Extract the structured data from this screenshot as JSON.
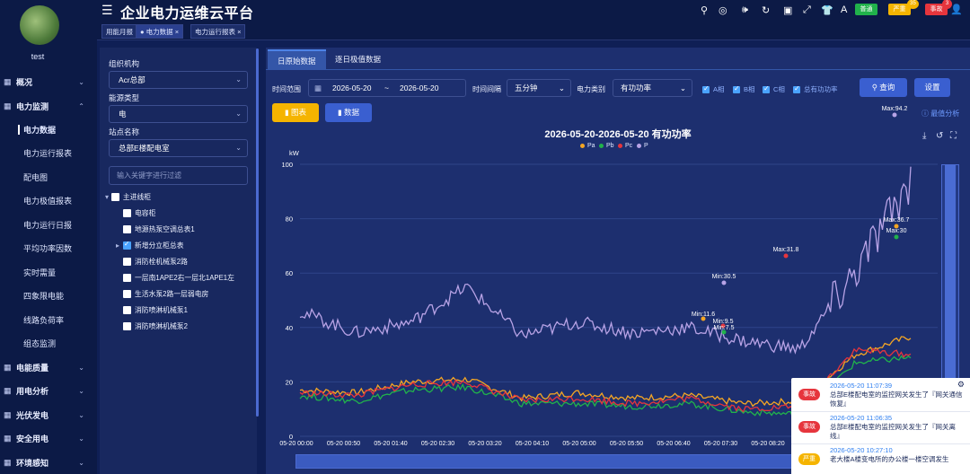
{
  "header": {
    "title": "企业电力运维云平台",
    "badges": [
      {
        "label": "普通",
        "color": "#21b24b"
      },
      {
        "label": "严重",
        "color": "#f5b400",
        "count": "35"
      },
      {
        "label": "事故",
        "color": "#e6353d",
        "count": "3"
      }
    ]
  },
  "user": {
    "name": "test"
  },
  "nav": {
    "items": [
      {
        "label": "概况",
        "icon": "chart-icon"
      },
      {
        "label": "电力监测",
        "icon": "gear-icon",
        "expanded": true
      },
      {
        "label": "电能质量",
        "icon": "lightning-icon"
      },
      {
        "label": "用电分析",
        "icon": "bar-icon"
      },
      {
        "label": "光伏发电",
        "icon": "solar-icon"
      },
      {
        "label": "安全用电",
        "icon": "shield-icon"
      },
      {
        "label": "环境感知",
        "icon": "env-icon"
      }
    ],
    "sub": [
      "电力数据",
      "电力运行报表",
      "配电图",
      "电力极值报表",
      "电力运行日报",
      "平均功率因数",
      "实时需量",
      "四象限电能",
      "线路负荷率",
      "组态监测"
    ]
  },
  "tabs": [
    "用能月报",
    "● 电力数据",
    "电力运行报表"
  ],
  "filter": {
    "org_label": "组织机构",
    "org_value": "Acr总部",
    "energy_label": "能源类型",
    "energy_value": "电",
    "site_label": "站点名称",
    "site_value": "总部E楼配电室",
    "keyword_placeholder": "输入关键字进行过滤"
  },
  "tree": {
    "root": "主进线柜",
    "items": [
      "电容柜",
      "地源热泵空调总表1",
      "新增分立柜总表",
      "消防栓机械泵2路",
      "一层南1APE2右一层北1APE1左",
      "生活水泵2路一层弱电房",
      "消防喷淋机械泵1",
      "消防喷淋机械泵2"
    ]
  },
  "main": {
    "tabs": [
      "日原始数据",
      "逐日极值数据"
    ],
    "time_range_label": "时间范围",
    "date_from": "2026-05-20",
    "date_sep": "~",
    "date_to": "2026-05-20",
    "interval_label": "时间间隔",
    "interval_value": "五分钟",
    "type_label": "电力类别",
    "type_value": "有功功率",
    "phases": [
      "A相",
      "B相",
      "C相",
      "总有功功率"
    ],
    "query_label": "查询",
    "settings_label": "设置",
    "chart_btn": "图表",
    "data_btn": "数据",
    "extreme_link": "最值分析"
  },
  "notices": [
    {
      "tag": "事故",
      "color": "#e6353d",
      "time": "2026-05-20 11:07:39",
      "text": "总部E楼配电室的监控网关发生了『网关通信恢复』"
    },
    {
      "tag": "事故",
      "color": "#e6353d",
      "time": "2026-05-20 11:06:35",
      "text": "总部E楼配电室的监控网关发生了『网关离线』"
    },
    {
      "tag": "严重",
      "color": "#f5b400",
      "time": "2026-05-20 10:27:10",
      "text": "老大楼A楼变电所的办公楼一楼空调发生"
    }
  ],
  "chart_data": {
    "type": "line",
    "title": "2026-05-20-2026-05-20  有功功率",
    "ylabel": "kW",
    "ylim": [
      0,
      100
    ],
    "grid": true,
    "legend": "top-center",
    "yticks": [
      0,
      20,
      40,
      60,
      80,
      100
    ],
    "x": [
      "05-20 00:00",
      "05-20 00:50",
      "05-20 01:40",
      "05-20 02:30",
      "05-20 03:20",
      "05-20 04:10",
      "05-20 05:00",
      "05-20 05:50",
      "05-20 06:40",
      "05-20 07:30",
      "05-20 08:20"
    ],
    "series": [
      {
        "name": "Pa",
        "color": "#f5a623",
        "values": [
          17,
          16,
          20,
          21,
          14,
          16,
          14,
          15,
          12,
          13,
          30,
          36.7
        ]
      },
      {
        "name": "Pb",
        "color": "#21b24b",
        "values": [
          15,
          13,
          17,
          18,
          12,
          12,
          11,
          12,
          9,
          8,
          27,
          29
        ]
      },
      {
        "name": "Pc",
        "color": "#e6353d",
        "values": [
          16,
          15,
          19,
          20,
          13,
          14,
          12,
          14,
          10,
          11,
          31.8,
          30
        ]
      },
      {
        "name": "P",
        "color": "#b8a3e6",
        "values": [
          46,
          38,
          42,
          55,
          37,
          42,
          38,
          40,
          35,
          32,
          60,
          94.2
        ]
      }
    ],
    "marks": [
      "Max:94.2",
      "Min:30.5",
      "Max:31.8",
      "Max:36.7",
      "Max:30",
      "Min:11.6",
      "Min:9.5",
      "Min:7.5"
    ]
  }
}
